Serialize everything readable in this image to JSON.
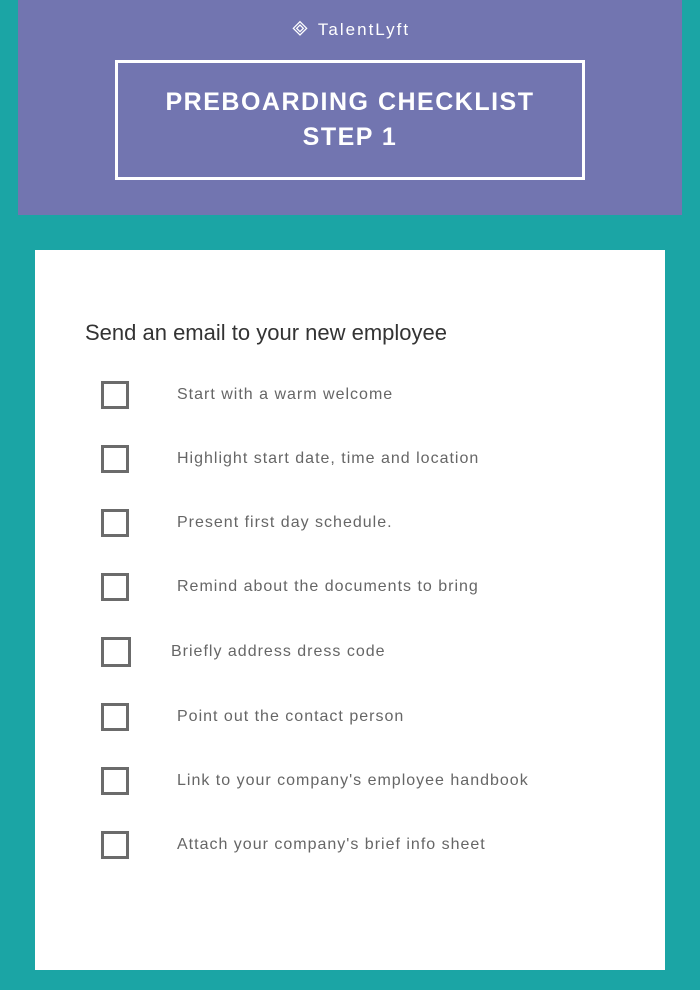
{
  "brand": {
    "name": "TalentLyft"
  },
  "header": {
    "title_line1": "PREBOARDING CHECKLIST",
    "title_line2": "STEP 1"
  },
  "main": {
    "section_title": "Send an email to your new employee",
    "items": [
      {
        "label": "Start with a warm welcome"
      },
      {
        "label": "Highlight start date, time and location"
      },
      {
        "label": "Present first day schedule."
      },
      {
        "label": "Remind about the documents to bring"
      },
      {
        "label": "Briefly address dress code"
      },
      {
        "label": "Point out the contact person"
      },
      {
        "label": "Link to your company's employee handbook"
      },
      {
        "label": "Attach your company's brief info sheet"
      }
    ]
  }
}
